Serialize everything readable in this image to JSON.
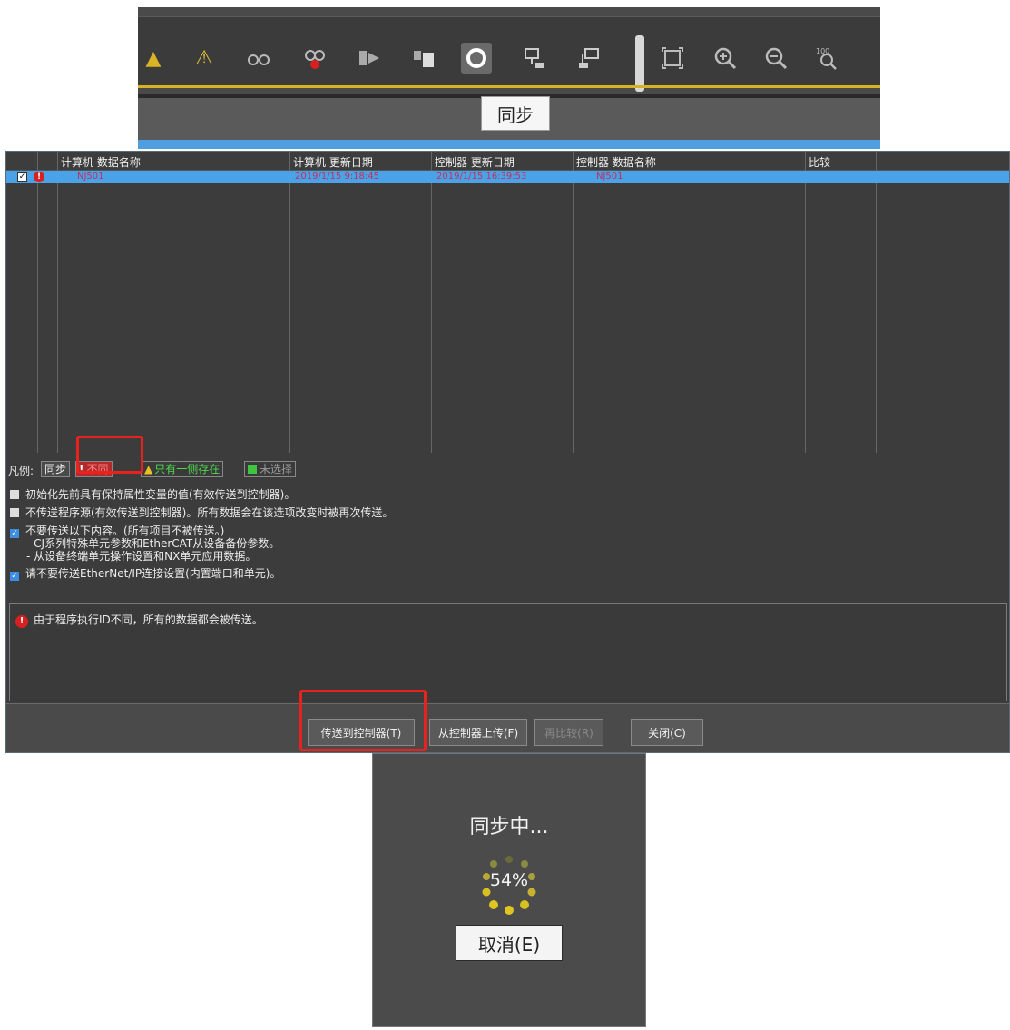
{
  "toolbar": {
    "tooltip": "同步",
    "icons": [
      "warning-icon",
      "warning-off-icon",
      "glasses-icon",
      "watch-icon",
      "transfer-icon",
      "upload-icon",
      "sync-icon",
      "online-icon",
      "offline-icon",
      "fit-icon",
      "zoom-in-icon",
      "zoom-out-icon",
      "zoom-100-icon"
    ]
  },
  "grid": {
    "headers": [
      "计算机 数据名称",
      "计算机 更新日期",
      "控制器 更新日期",
      "控制器 数据名称",
      "比较"
    ],
    "row": {
      "pc_name": "NJ501",
      "pc_date": "2019/1/15 9:18:45",
      "ctrl_date": "2019/1/15 16:39:53",
      "ctrl_name": "NJ501",
      "checked": "✓",
      "alert": "!"
    }
  },
  "legend": {
    "label": "凡例:",
    "sync": "同步",
    "diff": "不同",
    "one_side": "只有一侧存在",
    "unselected": "未选择"
  },
  "options": [
    {
      "text": "初始化先前具有保持属性变量的值(有效传送到控制器)。",
      "checked": false
    },
    {
      "text": "不传送程序源(有效传送到控制器)。所有数据会在该选项改变时被再次传送。",
      "checked": false
    },
    {
      "text": "不要传送以下内容。(所有项目不被传送。)",
      "checked": true
    },
    {
      "text": "- CJ系列特殊单元参数和EtherCAT从设备备份参数。",
      "checked": null
    },
    {
      "text": "- 从设备终端单元操作设置和NX单元应用数据。",
      "checked": null
    },
    {
      "text": "请不要传送EtherNet/IP连接设置(内置端口和单元)。",
      "checked": true
    }
  ],
  "message": "由于程序执行ID不同，所有的数据都会被传送。",
  "buttons": {
    "transfer_to": "传送到控制器(T)",
    "transfer_from": "从控制器上传(F)",
    "recompare": "再比较(R)",
    "close": "关闭(C)"
  },
  "progress": {
    "title": "同步中...",
    "percent": "54%",
    "value": 0.54,
    "cancel": "取消(E)"
  },
  "colors": {
    "accent_blue": "#4aa2e8",
    "highlight_red": "#e8231f",
    "diff_text": "#c0305a",
    "toolbar_gold": "#d9b326"
  }
}
